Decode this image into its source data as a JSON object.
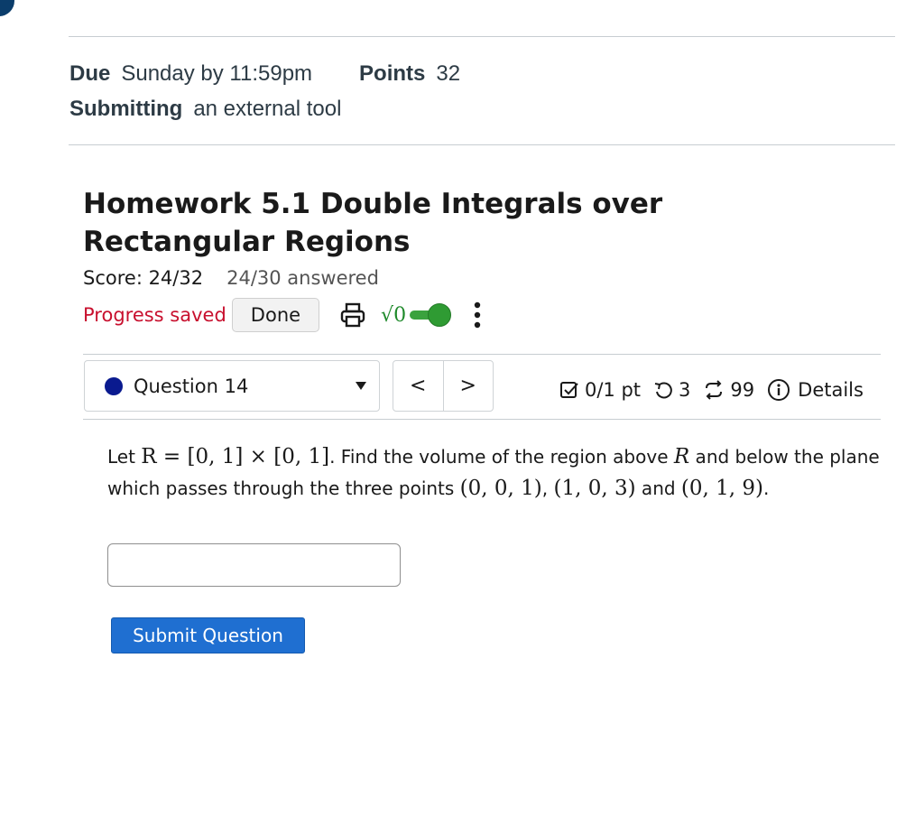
{
  "assignment": {
    "due_label": "Due",
    "due_value": "Sunday by 11:59pm",
    "points_label": "Points",
    "points_value": "32",
    "submitting_label": "Submitting",
    "submitting_value": "an external tool"
  },
  "homework": {
    "title": "Homework 5.1 Double Integrals over Rectangular Regions",
    "score": "Score: 24/32",
    "answered": "24/30 answered",
    "progress_status": "Progress saved",
    "done_label": "Done",
    "math_toggle_text": "√0",
    "math_toggle_on": true
  },
  "question": {
    "selector_label": "Question 14",
    "prev_label": "<",
    "next_label": ">",
    "points": "0/1 pt",
    "retries": "3",
    "attempts": "99",
    "details_label": "Details",
    "text_1": "Let ",
    "math_1": "R = [0, 1] × [0, 1]",
    "text_2": ". Find the volume of the region above ",
    "math_2": "R",
    "text_3": " and below the plane which passes through the three points ",
    "math_3": "(0, 0, 1)",
    "text_4": ", ",
    "math_4": "(1, 0, 3)",
    "text_5": " and ",
    "math_5": "(0, 1, 9)",
    "text_6": ".",
    "answer_value": "",
    "submit_label": "Submit Question"
  },
  "icons": {
    "print": "printer-icon",
    "menu": "kebab-menu-icon",
    "points": "checkbox-icon",
    "retries": "undo-icon",
    "attempts": "retry-arrows-icon",
    "details": "info-icon"
  },
  "colors": {
    "progress_saved": "#c8102e",
    "toggle_on": "#2f9b33",
    "submit_button": "#1f6fd1",
    "question_dot": "#0a1a8f"
  }
}
